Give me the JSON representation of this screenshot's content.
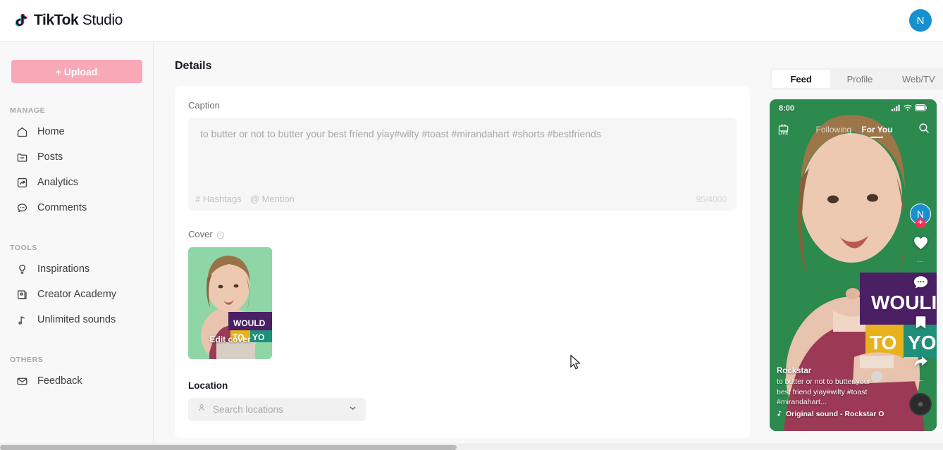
{
  "topbar": {
    "logo_text_bold": "TikTok",
    "logo_text_thin": " Studio",
    "avatar_initial": "N"
  },
  "sidebar": {
    "upload_label": "+ Upload",
    "sections": [
      {
        "label": "MANAGE",
        "items": [
          {
            "label": "Home",
            "icon": "home-icon"
          },
          {
            "label": "Posts",
            "icon": "folder-icon"
          },
          {
            "label": "Analytics",
            "icon": "analytics-icon"
          },
          {
            "label": "Comments",
            "icon": "comment-icon"
          }
        ]
      },
      {
        "label": "TOOLS",
        "items": [
          {
            "label": "Inspirations",
            "icon": "lightbulb-icon"
          },
          {
            "label": "Creator Academy",
            "icon": "book-icon"
          },
          {
            "label": "Unlimited sounds",
            "icon": "music-note-icon"
          }
        ]
      },
      {
        "label": "OTHERS",
        "items": [
          {
            "label": "Feedback",
            "icon": "envelope-icon"
          }
        ]
      }
    ]
  },
  "main": {
    "page_title": "Details",
    "caption": {
      "label": "Caption",
      "value": "to butter or not to butter your best friend yiay#wilty #toast #mirandahart #shorts #bestfriends",
      "hashtags_label": "# Hashtags",
      "mention_label": "@ Mention",
      "counter": "95/4000"
    },
    "cover": {
      "label": "Cover",
      "edit_label": "Edit cover",
      "thumb_text_1": "WOULD",
      "thumb_text_2": "TO YO"
    },
    "location": {
      "label": "Location",
      "placeholder": "Search locations"
    }
  },
  "preview": {
    "tabs": [
      {
        "label": "Feed",
        "active": true
      },
      {
        "label": "Profile",
        "active": false
      },
      {
        "label": "Web/TV",
        "active": false
      }
    ],
    "phone": {
      "status_time": "8:00",
      "live_label": "LIVE",
      "feed_tab_following": "Following",
      "feed_tab_foryou": "For You",
      "avatar_initial": "N",
      "plus_badge": "+",
      "username": "Rockstar",
      "caption": "to butter or not to butter your best friend yiay#wilty #toast #mirandahart...",
      "music": "Original sound - Rockstar    Original s",
      "video_text_1": "WOULD",
      "video_text_2": "TO YOU"
    }
  },
  "colors": {
    "accent_pink": "#f9a8b8",
    "avatar_blue": "#1790d0",
    "badge_red": "#fe2c55",
    "video_green": "#2d8a4e"
  }
}
